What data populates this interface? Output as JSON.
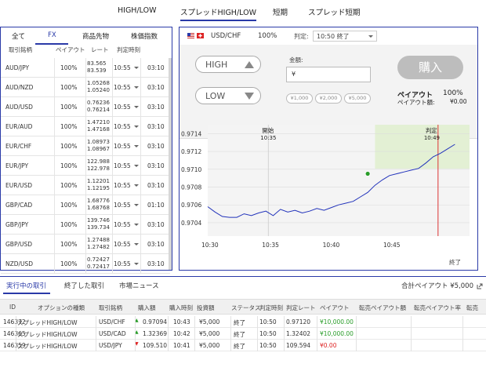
{
  "topnav": [
    "HIGH/LOW",
    "スプレッドHIGH/LOW",
    "短期",
    "スプレッド短期"
  ],
  "left": {
    "tabs": [
      "全て",
      "FX",
      "商品先物",
      "株価指数"
    ],
    "headers": [
      "取引銘柄",
      "ペイアウト",
      "レート",
      "判定時刻"
    ],
    "rows": [
      {
        "sym": "AUD/JPY",
        "payout": "100%",
        "rate_hi": "83.565",
        "rate_lo": "83.539",
        "expiry": "10:55",
        "dur": "03:10"
      },
      {
        "sym": "AUD/NZD",
        "payout": "100%",
        "rate_hi": "1.05268",
        "rate_lo": "1.05240",
        "expiry": "10:55",
        "dur": "03:10"
      },
      {
        "sym": "AUD/USD",
        "payout": "100%",
        "rate_hi": "0.76236",
        "rate_lo": "0.76214",
        "expiry": "10:55",
        "dur": "03:10"
      },
      {
        "sym": "EUR/AUD",
        "payout": "100%",
        "rate_hi": "1.47210",
        "rate_lo": "1.47168",
        "expiry": "10:55",
        "dur": "03:10"
      },
      {
        "sym": "EUR/CHF",
        "payout": "100%",
        "rate_hi": "1.08973",
        "rate_lo": "1.08967",
        "expiry": "10:55",
        "dur": "03:10"
      },
      {
        "sym": "EUR/JPY",
        "payout": "100%",
        "rate_hi": "122.988",
        "rate_lo": "122.978",
        "expiry": "10:55",
        "dur": "03:10"
      },
      {
        "sym": "EUR/USD",
        "payout": "100%",
        "rate_hi": "1.12201",
        "rate_lo": "1.12195",
        "expiry": "10:55",
        "dur": "03:10"
      },
      {
        "sym": "GBP/CAD",
        "payout": "100%",
        "rate_hi": "1.68776",
        "rate_lo": "1.68768",
        "expiry": "10:55",
        "dur": "01:10"
      },
      {
        "sym": "GBP/JPY",
        "payout": "100%",
        "rate_hi": "139.746",
        "rate_lo": "139.734",
        "expiry": "10:55",
        "dur": "03:10"
      },
      {
        "sym": "GBP/USD",
        "payout": "100%",
        "rate_hi": "1.27488",
        "rate_lo": "1.27482",
        "expiry": "10:55",
        "dur": "03:10"
      },
      {
        "sym": "NZD/USD",
        "payout": "100%",
        "rate_hi": "0.72427",
        "rate_lo": "0.72417",
        "expiry": "10:55",
        "dur": "03:10"
      }
    ]
  },
  "trade": {
    "symbol": "USD/CHF",
    "payout_pct": "100%",
    "expiry_label": "判定:",
    "expiry_value": "10:50 終了",
    "high_label": "HIGH",
    "low_label": "LOW",
    "amount_label": "金額:",
    "amount_value": "¥",
    "chips": [
      "¥1,000",
      "¥2,000",
      "¥5,000"
    ],
    "buy_label": "購入",
    "payout_label": "ペイアウト",
    "payout_value": "100%",
    "payout_amount_label": "ペイアウト額:",
    "payout_amount_value": "¥0.00"
  },
  "chart_data": {
    "type": "line",
    "start_label": "開始",
    "start_time": "10:35",
    "end_label": "判定",
    "end_time": "10:49",
    "status_label": "終了",
    "y_ticks": [
      "0.9714",
      "0.9712",
      "0.9710",
      "0.9708",
      "0.9706",
      "0.9704"
    ],
    "x_ticks": [
      "10:30",
      "10:35",
      "10:40",
      "10:45"
    ],
    "ylim": [
      0.97025,
      0.9715
    ],
    "x": [
      10.5,
      10.51,
      10.52,
      10.53,
      10.54,
      10.55,
      10.56,
      10.57,
      10.58,
      10.59,
      10.6,
      10.61,
      10.62,
      10.63,
      10.64,
      10.65,
      10.66,
      10.67,
      10.68,
      10.69,
      10.7,
      10.71,
      10.72,
      10.73,
      10.74,
      10.75,
      10.76,
      10.77,
      10.78,
      10.79,
      10.8,
      10.81,
      10.82,
      10.83,
      10.84
    ],
    "y": [
      0.97058,
      0.97052,
      0.97047,
      0.97046,
      0.97046,
      0.9705,
      0.97048,
      0.97051,
      0.97053,
      0.97048,
      0.97055,
      0.97052,
      0.97054,
      0.97051,
      0.97053,
      0.97056,
      0.97054,
      0.97057,
      0.9706,
      0.97062,
      0.97064,
      0.97069,
      0.97074,
      0.97082,
      0.97088,
      0.97093,
      0.97095,
      0.97097,
      0.97099,
      0.97101,
      0.97107,
      0.97114,
      0.97118,
      0.97123,
      0.97128
    ]
  },
  "bottom": {
    "tabs": [
      "実行中の取引",
      "終了した取引",
      "市場ニュース"
    ],
    "total": "合計ペイアウト ¥5,000",
    "headers": [
      "ID",
      "オプションの種類",
      "取引銘柄",
      "購入額",
      "購入時刻",
      "投資額",
      "ステータス",
      "判定時刻",
      "判定レート",
      "ペイアウト",
      "転売ペイアウト額",
      "転売ペイアウト率",
      "転売"
    ],
    "rows": [
      {
        "id": "146372",
        "type": "スプレッドHIGH/LOW",
        "sym": "USD/CHF",
        "dir": "up",
        "buy": "0.97094",
        "time": "10:43",
        "inv": "¥5,000",
        "status": "終了",
        "exp": "10:50",
        "rate": "0.97120",
        "payout": "¥10,000.00"
      },
      {
        "id": "146365",
        "type": "スプレッドHIGH/LOW",
        "sym": "USD/CAD",
        "dir": "up",
        "buy": "1.32369",
        "time": "10:42",
        "inv": "¥5,000",
        "status": "終了",
        "exp": "10:50",
        "rate": "1.32402",
        "payout": "¥10,000.00"
      },
      {
        "id": "146359",
        "type": "スプレッドHIGH/LOW",
        "sym": "USD/JPY",
        "dir": "down",
        "buy": "109.510",
        "time": "10:41",
        "inv": "¥5,000",
        "status": "終了",
        "exp": "10:50",
        "rate": "109.594",
        "payout": "¥0.00"
      }
    ]
  }
}
